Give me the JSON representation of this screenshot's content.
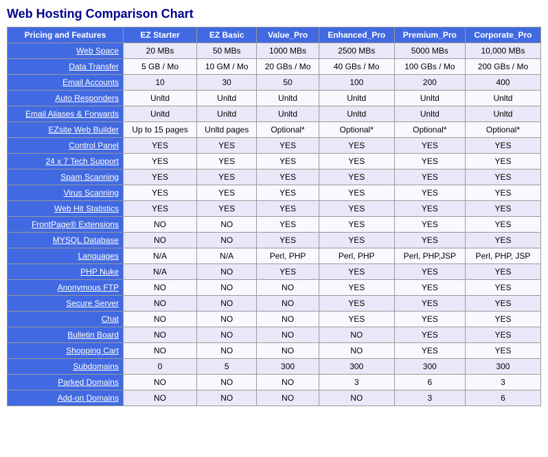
{
  "title": "Web Hosting Comparison Chart",
  "headers": [
    "Pricing and Features",
    "EZ Starter",
    "EZ Basic",
    "Value_Pro",
    "Enhanced_Pro",
    "Premium_Pro",
    "Corporate_Pro"
  ],
  "rows": [
    {
      "feature": "Web Space",
      "values": [
        "20 MBs",
        "50 MBs",
        "1000 MBs",
        "2500 MBs",
        "5000 MBs",
        "10,000 MBs"
      ]
    },
    {
      "feature": "Data Transfer",
      "values": [
        "5 GB / Mo",
        "10 GM / Mo",
        "20 GBs / Mo",
        "40 GBs / Mo",
        "100 GBs / Mo",
        "200 GBs / Mo"
      ]
    },
    {
      "feature": "Email Accounts",
      "values": [
        "10",
        "30",
        "50",
        "100",
        "200",
        "400"
      ]
    },
    {
      "feature": "Auto Responders",
      "values": [
        "Unltd",
        "Unltd",
        "Unltd",
        "Unltd",
        "Unltd",
        "Unltd"
      ]
    },
    {
      "feature": "Email Aliases & Forwards",
      "values": [
        "Unltd",
        "Unltd",
        "Unltd",
        "Unltd",
        "Unltd",
        "Unltd"
      ]
    },
    {
      "feature": "EZsite Web Builder",
      "values": [
        "Up to 15 pages",
        "Unltd pages",
        "Optional*",
        "Optional*",
        "Optional*",
        "Optional*"
      ]
    },
    {
      "feature": "Control Panel",
      "values": [
        "YES",
        "YES",
        "YES",
        "YES",
        "YES",
        "YES"
      ]
    },
    {
      "feature": "24 x 7 Tech Support",
      "values": [
        "YES",
        "YES",
        "YES",
        "YES",
        "YES",
        "YES"
      ]
    },
    {
      "feature": "Spam Scanning",
      "values": [
        "YES",
        "YES",
        "YES",
        "YES",
        "YES",
        "YES"
      ]
    },
    {
      "feature": "Virus Scanning",
      "values": [
        "YES",
        "YES",
        "YES",
        "YES",
        "YES",
        "YES"
      ]
    },
    {
      "feature": "Web Hit Statistics",
      "values": [
        "YES",
        "YES",
        "YES",
        "YES",
        "YES",
        "YES"
      ]
    },
    {
      "feature": "FrontPage® Extensions",
      "values": [
        "NO",
        "NO",
        "YES",
        "YES",
        "YES",
        "YES"
      ]
    },
    {
      "feature": "MYSQL Database",
      "values": [
        "NO",
        "NO",
        "YES",
        "YES",
        "YES",
        "YES"
      ]
    },
    {
      "feature": "Languages",
      "values": [
        "N/A",
        "N/A",
        "Perl, PHP",
        "Perl, PHP",
        "Perl, PHP,JSP",
        "Perl, PHP, JSP"
      ]
    },
    {
      "feature": "PHP Nuke",
      "values": [
        "N/A",
        "NO",
        "YES",
        "YES",
        "YES",
        "YES"
      ]
    },
    {
      "feature": "Anonymous FTP",
      "values": [
        "NO",
        "NO",
        "NO",
        "YES",
        "YES",
        "YES"
      ]
    },
    {
      "feature": "Secure Server",
      "values": [
        "NO",
        "NO",
        "NO",
        "YES",
        "YES",
        "YES"
      ]
    },
    {
      "feature": "Chat",
      "values": [
        "NO",
        "NO",
        "NO",
        "YES",
        "YES",
        "YES"
      ]
    },
    {
      "feature": "Bulletin Board",
      "values": [
        "NO",
        "NO",
        "NO",
        "NO",
        "YES",
        "YES"
      ]
    },
    {
      "feature": "Shopping Cart",
      "values": [
        "NO",
        "NO",
        "NO",
        "NO",
        "YES",
        "YES"
      ]
    },
    {
      "feature": "Subdomains",
      "values": [
        "0",
        "5",
        "300",
        "300",
        "300",
        "300"
      ]
    },
    {
      "feature": "Parked Domains",
      "values": [
        "NO",
        "NO",
        "NO",
        "3",
        "6",
        "3"
      ]
    },
    {
      "feature": "Add-on Domains",
      "values": [
        "NO",
        "NO",
        "NO",
        "NO",
        "3",
        "6"
      ]
    }
  ]
}
